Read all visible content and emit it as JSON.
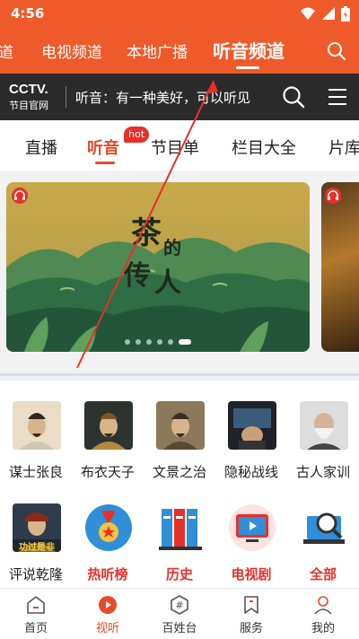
{
  "status": {
    "time": "4:56"
  },
  "channels": [
    "道",
    "电视频道",
    "本地广播",
    "听音频道"
  ],
  "channels_active": 3,
  "cctv": {
    "logo": "CCTV.",
    "logo_sub": "节目官网",
    "slogan": "听音：有一种美好，可以听见"
  },
  "tabs": [
    "直播",
    "听音",
    "节目单",
    "栏目大全",
    "片库"
  ],
  "tabs_active": 1,
  "hot_badge": "hot",
  "banner": {
    "title": "茶的传人",
    "slides": 6,
    "active_slide": 5
  },
  "grid": [
    {
      "label": "谋士张良",
      "icon": "portrait-zhangliang-icon",
      "style": "normal"
    },
    {
      "label": "布衣天子",
      "icon": "portrait-emperor-icon",
      "style": "normal"
    },
    {
      "label": "文景之治",
      "icon": "portrait-wenjing-icon",
      "style": "normal"
    },
    {
      "label": "隐秘战线",
      "icon": "portrait-spy-icon",
      "style": "normal"
    },
    {
      "label": "古人家训",
      "icon": "portrait-elder-icon",
      "style": "normal"
    },
    {
      "label": "评说乾隆",
      "icon": "portrait-qianlong-icon",
      "style": "normal",
      "thumb_text": "功过是非"
    },
    {
      "label": "热听榜",
      "icon": "medal-icon",
      "style": "red"
    },
    {
      "label": "历史",
      "icon": "books-icon",
      "style": "red"
    },
    {
      "label": "电视剧",
      "icon": "tv-play-icon",
      "style": "red"
    },
    {
      "label": "全部",
      "icon": "search-laptop-icon",
      "style": "red"
    }
  ],
  "bottom_nav": [
    {
      "label": "首页",
      "icon": "home-icon"
    },
    {
      "label": "视听",
      "icon": "play-circle-icon"
    },
    {
      "label": "百姓台",
      "icon": "hashtag-icon"
    },
    {
      "label": "服务",
      "icon": "bookmark-icon"
    },
    {
      "label": "我的",
      "icon": "profile-icon"
    }
  ],
  "bottom_nav_active": 1,
  "colors": {
    "brand": "#ee5a2a",
    "accent": "#e8302a",
    "dark_bar": "#2b2b2b"
  }
}
